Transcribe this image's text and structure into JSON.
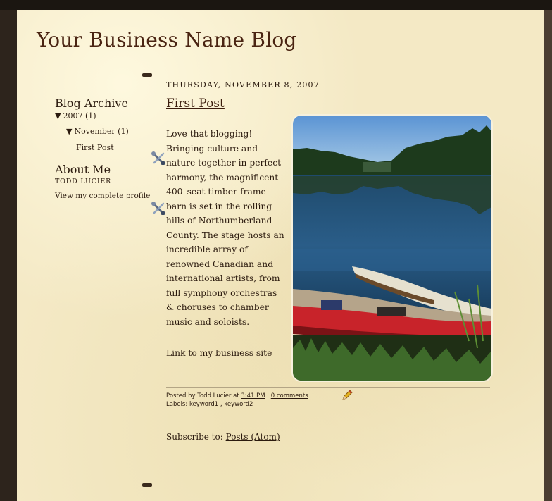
{
  "blog": {
    "title": "Your Business Name Blog"
  },
  "sidebar": {
    "archive_heading": "Blog Archive",
    "year_label": "2007 (1)",
    "month_label": "November (1)",
    "post_link": "First Post",
    "about_heading": "About Me",
    "author_name": "TODD LUCIER",
    "profile_link": "View my complete profile"
  },
  "post": {
    "date": "THURSDAY, NOVEMBER 8, 2007",
    "title": "First Post",
    "body": "Love that blogging! Bringing culture and nature together in perfect harmony, the magnificent 400–seat timber-frame barn is set in the rolling hills of Northumberland County. The stage hosts an incredible array of renowned Canadian and international artists, from full symphony orchestras & choruses to chamber music and soloists.",
    "business_link": "Link to my business site",
    "image_alt": "Lake with canoes"
  },
  "footer": {
    "posted_by_prefix": "Posted by Todd Lucier at",
    "time": "3:41 PM",
    "comments": "0 comments",
    "labels_prefix": "Labels:",
    "label1": "keyword1",
    "label_sep": ",",
    "label2": "keyword2",
    "subscribe_prefix": "Subscribe to:",
    "subscribe_link": "Posts (Atom)"
  },
  "icons": {
    "quick_edit": "wrench-screwdriver-icon",
    "edit_post": "pencil-icon",
    "arrow": "triangle-down-icon"
  },
  "colors": {
    "page_background": "#f4e9c5",
    "frame": "#2d241c",
    "title_color": "#4a2412"
  }
}
